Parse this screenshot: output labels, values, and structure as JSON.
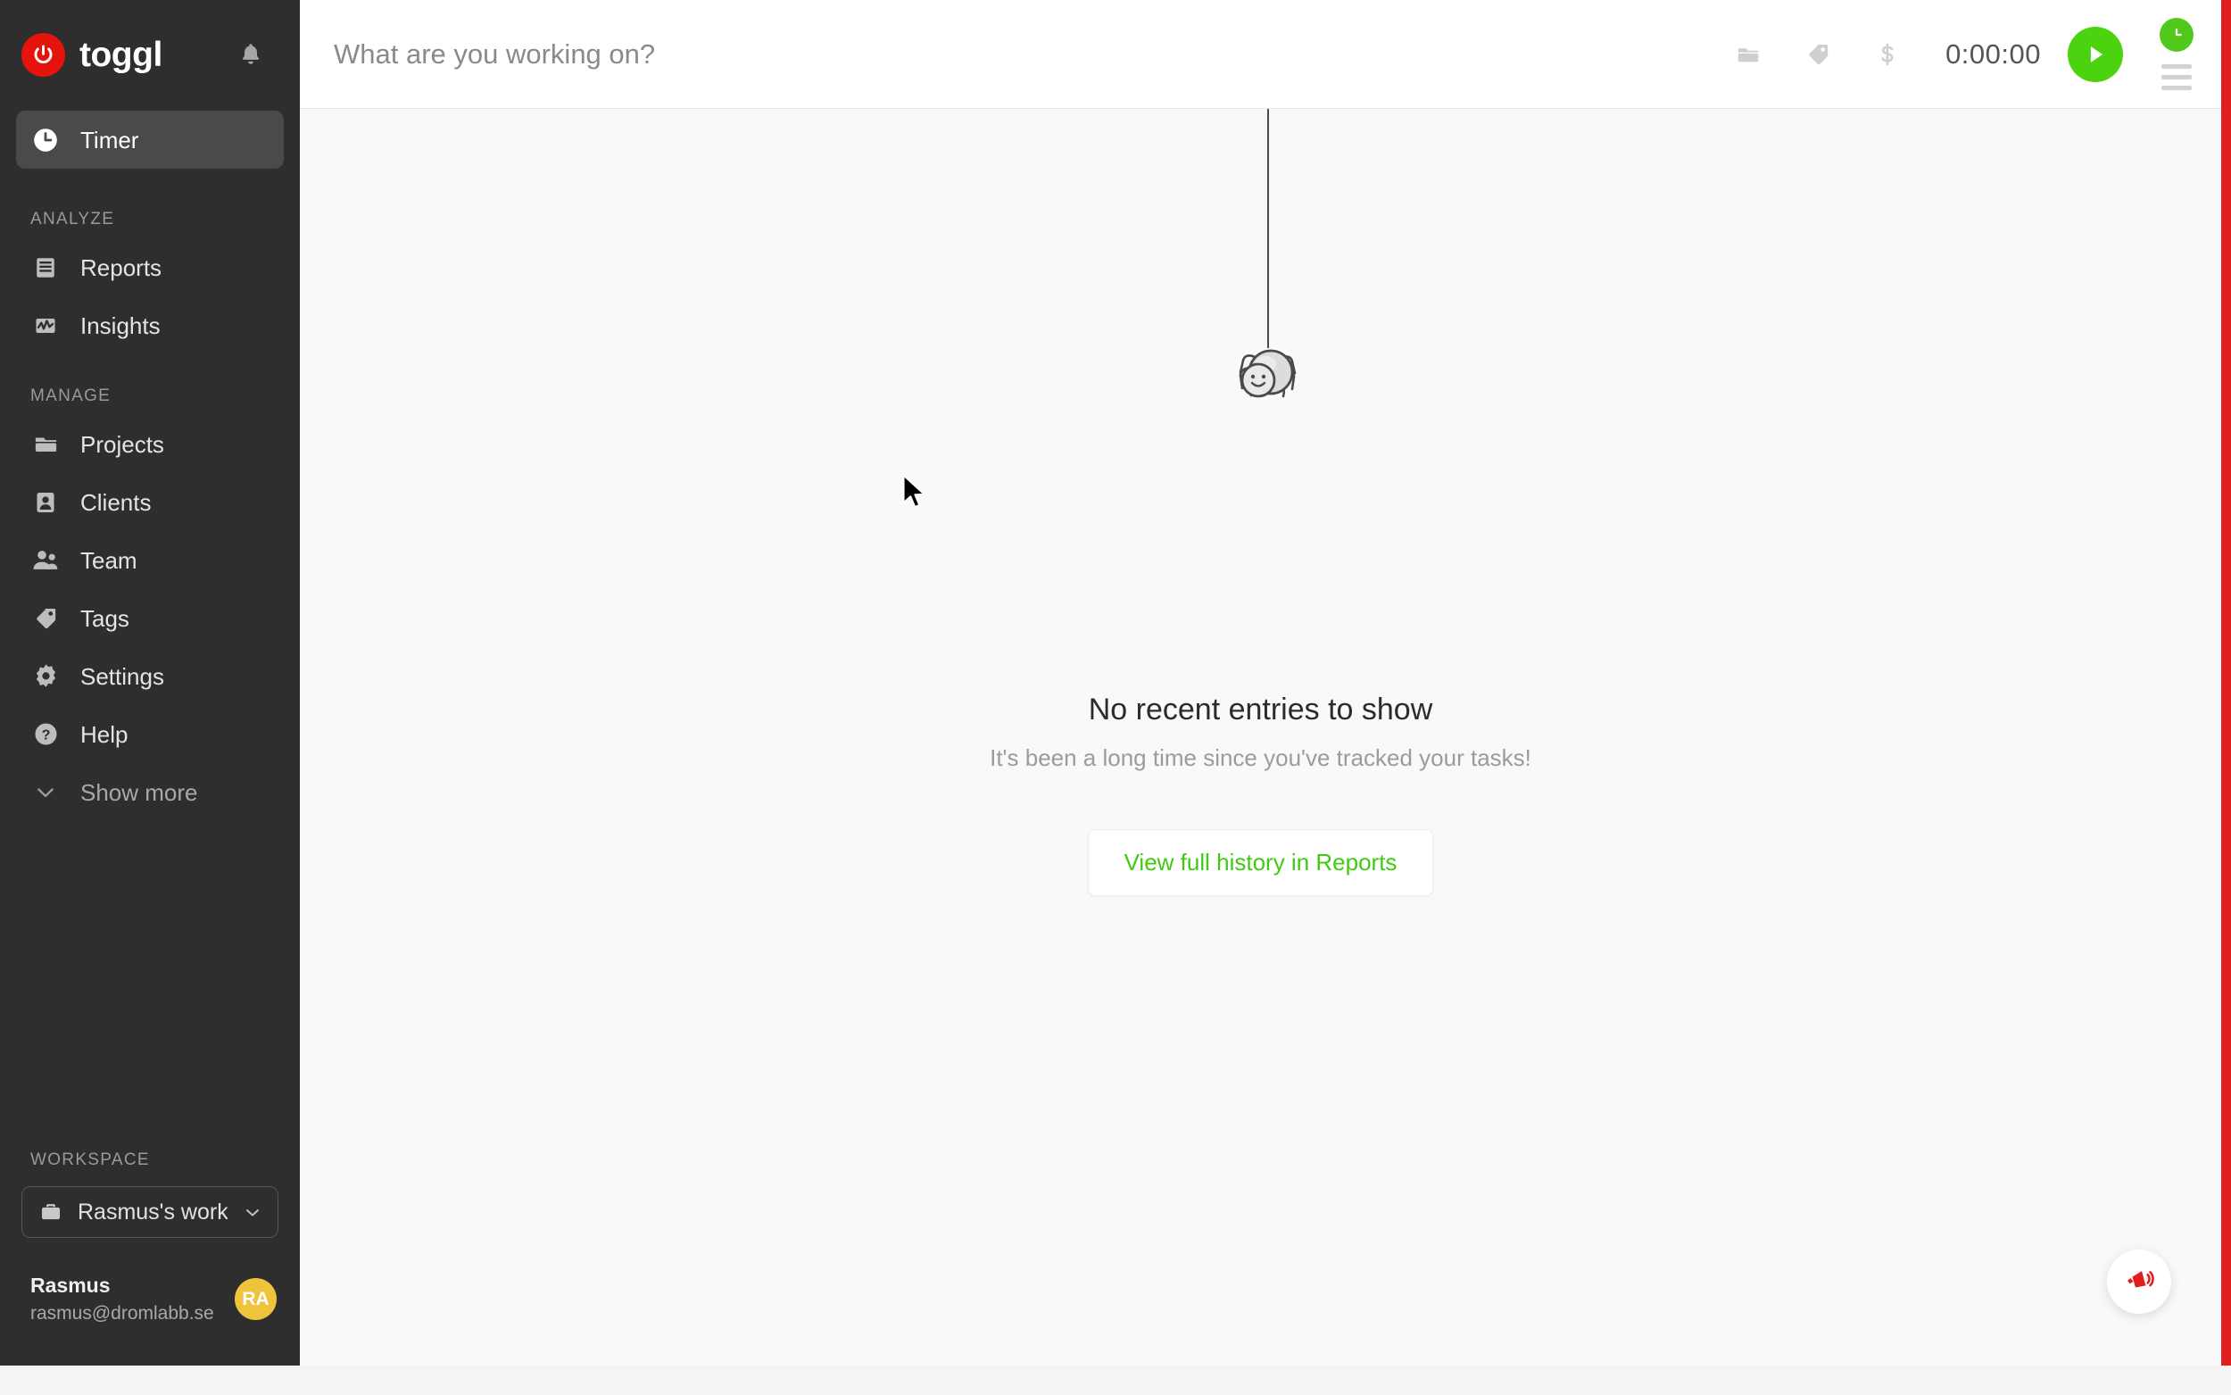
{
  "brand": {
    "name": "toggl",
    "logo_color": "#e6130c",
    "bell_icon": "bell-icon"
  },
  "sidebar": {
    "primary": [
      {
        "label": "Timer",
        "icon": "clock-icon",
        "active": true
      }
    ],
    "sections": [
      {
        "title": "ANALYZE",
        "items": [
          {
            "label": "Reports",
            "icon": "reports-icon"
          },
          {
            "label": "Insights",
            "icon": "insights-icon"
          }
        ]
      },
      {
        "title": "MANAGE",
        "items": [
          {
            "label": "Projects",
            "icon": "folder-icon"
          },
          {
            "label": "Clients",
            "icon": "person-card-icon"
          },
          {
            "label": "Team",
            "icon": "people-icon"
          },
          {
            "label": "Tags",
            "icon": "tag-icon"
          },
          {
            "label": "Settings",
            "icon": "gear-icon"
          },
          {
            "label": "Help",
            "icon": "question-circle-icon"
          }
        ]
      }
    ],
    "show_more": {
      "label": "Show more",
      "icon": "chevron-down-icon"
    },
    "workspace": {
      "section_label": "WORKSPACE",
      "name": "Rasmus's work...",
      "icon": "briefcase-icon",
      "chevron": "chevron-down-icon"
    },
    "user": {
      "name": "Rasmus",
      "email": "rasmus@dromlabb.se",
      "initials": "RA",
      "avatar_color": "#f0c33c"
    }
  },
  "topbar": {
    "input_placeholder": "What are you working on?",
    "input_value": "",
    "project_icon": "folder-icon",
    "tag_icon": "tag-icon",
    "billable_icon": "dollar-icon",
    "timer_value": "0:00:00",
    "play_icon": "play-icon",
    "play_color": "#4bd310",
    "clock_badge_icon": "clock-icon",
    "clock_badge_color": "#52c81a",
    "menu_icon": "hamburger-menu-icon"
  },
  "empty_state": {
    "illustration": "hanging-spider-icon",
    "title": "No recent entries to show",
    "subtitle": "It's been a long time since you've tracked your tasks!",
    "cta_label": "View full history in Reports",
    "cta_color": "#3fcc10"
  },
  "fab": {
    "icon": "megaphone-icon",
    "color": "#e01e1e"
  },
  "cursor": {
    "icon": "arrow-cursor-icon"
  }
}
